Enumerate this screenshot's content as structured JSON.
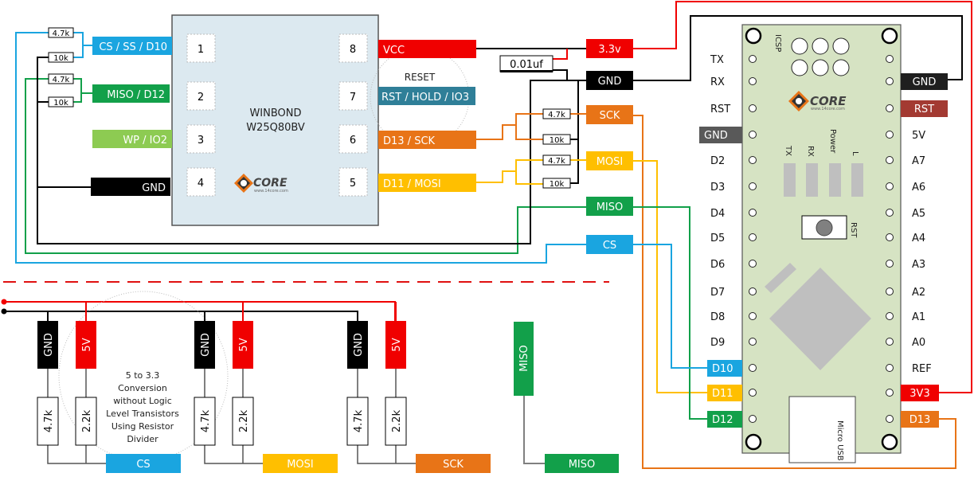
{
  "colors": {
    "cs": "#1aa5e0",
    "miso": "#12a04a",
    "wp": "#8dcb52",
    "gnd": "#000000",
    "vcc": "#f00000",
    "rst": "#2f7f98",
    "sck": "#e87417",
    "mosi": "#ffbf00",
    "chip_body": "#dce9f0",
    "board_body": "#d6e3c3",
    "board_gnd": "#595959",
    "board_rst": "#a33a32",
    "chip_gray": "#bfbfbf"
  },
  "chip": {
    "name_line1": "WINBOND",
    "name_line2": "W25Q80BV",
    "pins_left": [
      "1",
      "2",
      "3",
      "4"
    ],
    "pins_right": [
      "8",
      "7",
      "6",
      "5"
    ],
    "labels_left": [
      "CS / SS / D10",
      "MISO / D12",
      "WP / IO2",
      "GND"
    ],
    "labels_right": [
      "VCC",
      "RST / HOLD / IO3",
      "D13 / SCK",
      "D11 / MOSI"
    ],
    "reset_note": "RESET",
    "logo_text": "CORE",
    "logo_url_text": "www.14core.com"
  },
  "left_resistors": [
    "4.7k",
    "10k",
    "4.7k",
    "10k"
  ],
  "right_resistors": [
    "4.7k",
    "10k",
    "4.7k",
    "10k"
  ],
  "capacitor": "0.01uf",
  "mid_labels": [
    "3.3v",
    "GND",
    "SCK",
    "MOSI",
    "MISO",
    "CS"
  ],
  "board": {
    "icsp": "ICSP",
    "leds": [
      "TX",
      "RX",
      "Power",
      "L"
    ],
    "reset_button": "RST",
    "usb": "Micro USB",
    "logo_text": "CORE",
    "logo_url_text": "www.14core.com",
    "left_pins": [
      "TX",
      "RX",
      "RST",
      "GND",
      "D2",
      "D3",
      "D4",
      "D5",
      "D6",
      "D7",
      "D8",
      "D9",
      "D10",
      "D11",
      "D12"
    ],
    "right_pins": [
      "",
      "GND",
      "RST",
      "5V",
      "A7",
      "A6",
      "A5",
      "A4",
      "A3",
      "A2",
      "A1",
      "A0",
      "REF",
      "3V3",
      "D13"
    ]
  },
  "divider": {
    "note": [
      "5 to 3.3",
      "Conversion",
      "without Logic",
      "Level Transistors",
      "Using Resistor",
      "Divider"
    ],
    "groups": [
      {
        "gnd": "GND",
        "vcc": "5V",
        "r1": "4.7k",
        "r2": "2.2k",
        "out": "CS"
      },
      {
        "gnd": "GND",
        "vcc": "5V",
        "r1": "4.7k",
        "r2": "2.2k",
        "out": "MOSI"
      },
      {
        "gnd": "GND",
        "vcc": "5V",
        "r1": "4.7k",
        "r2": "2.2k",
        "out": "SCK"
      }
    ],
    "miso_vertical": "MISO",
    "miso_out": "MISO"
  }
}
